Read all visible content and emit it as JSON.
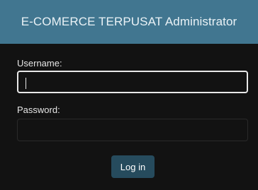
{
  "header": {
    "title": "E-COMERCE TERPUSAT Administrator"
  },
  "form": {
    "username_label": "Username:",
    "username_value": "",
    "password_label": "Password:",
    "password_value": "",
    "submit_label": "Log in"
  },
  "colors": {
    "header_bg": "#417690",
    "panel_bg": "#121212",
    "button_bg": "#264b5d",
    "label_text": "#e6e6e6"
  }
}
